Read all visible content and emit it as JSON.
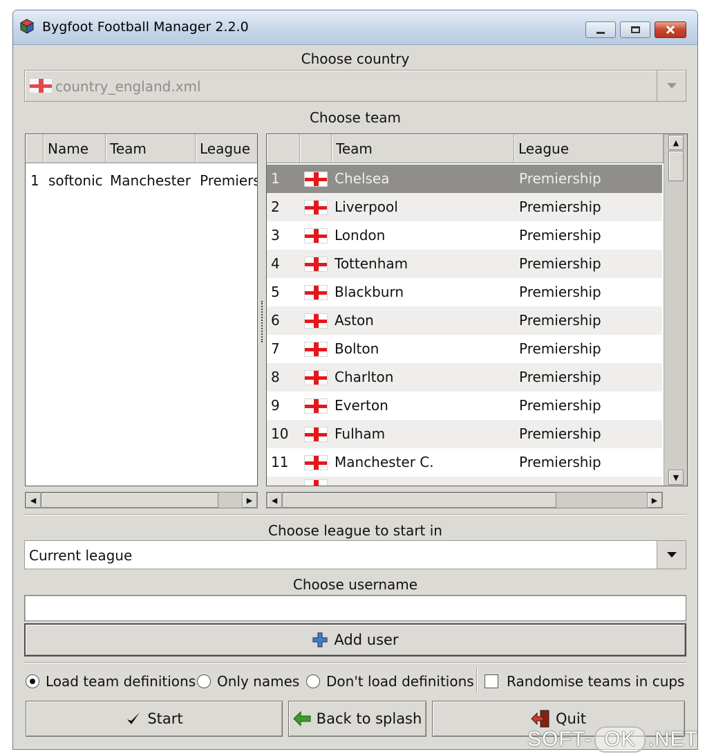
{
  "window": {
    "title": "Bygfoot Football Manager 2.2.0"
  },
  "country": {
    "label": "Choose country",
    "selected": "country_england.xml"
  },
  "team_section": {
    "label": "Choose team"
  },
  "users_table": {
    "headers": [
      "",
      "Name",
      "Team",
      "League"
    ],
    "rows": [
      {
        "num": "1",
        "name": "softonic",
        "team": "Manchester",
        "league": "Premiership"
      }
    ]
  },
  "teams_table": {
    "headers": [
      "",
      "",
      "Team",
      "League"
    ],
    "rows": [
      {
        "num": "1",
        "team": "Chelsea",
        "league": "Premiership",
        "selected": true
      },
      {
        "num": "2",
        "team": "Liverpool",
        "league": "Premiership"
      },
      {
        "num": "3",
        "team": "London",
        "league": "Premiership"
      },
      {
        "num": "4",
        "team": "Tottenham",
        "league": "Premiership"
      },
      {
        "num": "5",
        "team": "Blackburn",
        "league": "Premiership"
      },
      {
        "num": "6",
        "team": "Aston",
        "league": "Premiership"
      },
      {
        "num": "7",
        "team": "Bolton",
        "league": "Premiership"
      },
      {
        "num": "8",
        "team": "Charlton",
        "league": "Premiership"
      },
      {
        "num": "9",
        "team": "Everton",
        "league": "Premiership"
      },
      {
        "num": "10",
        "team": "Fulham",
        "league": "Premiership"
      },
      {
        "num": "11",
        "team": "Manchester C.",
        "league": "Premiership"
      }
    ]
  },
  "league_start": {
    "label": "Choose league to start in",
    "selected": "Current league"
  },
  "username": {
    "label": "Choose username",
    "value": "",
    "add_button": "Add user"
  },
  "definitions": {
    "options": [
      "Load team definitions",
      "Only names",
      "Don't load definitions"
    ],
    "selected_index": 0,
    "randomise_label": "Randomise teams in cups",
    "randomise_checked": false
  },
  "buttons": {
    "start": "Start",
    "back": "Back to splash",
    "quit": "Quit"
  },
  "watermark": {
    "left": "SOFT-",
    "middle": "OK",
    "right": ".NET"
  },
  "colors": {
    "selection": "#8f8e8b",
    "flag_red": "#e4181c",
    "add_icon": "#4a78c2",
    "back_icon": "#3e9a2a"
  }
}
